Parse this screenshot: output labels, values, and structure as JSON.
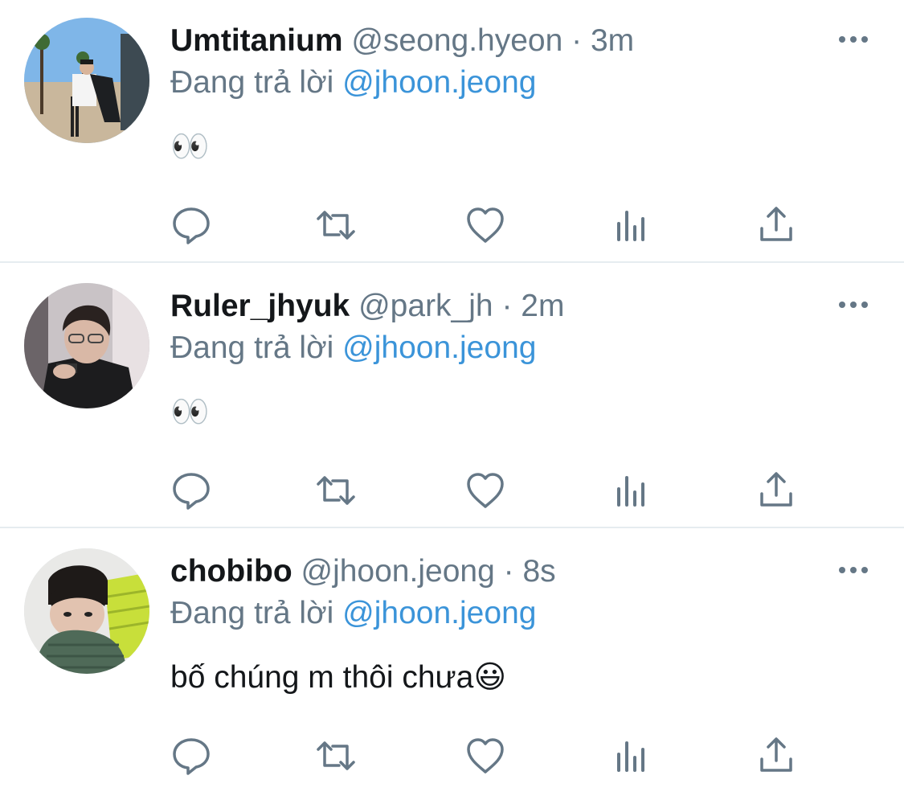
{
  "colors": {
    "link": "#3b94d9",
    "secondary_text": "#657786",
    "primary_text": "#14171a",
    "icon": "#657786",
    "divider": "#e6ecf0"
  },
  "icons": {
    "reply": "speech-bubble-icon",
    "retweet": "retweet-icon",
    "like": "heart-icon",
    "views": "bar-chart-icon",
    "share": "share-upload-icon",
    "more": "more-horizontal-icon"
  },
  "tweets": [
    {
      "display_name": "Umtitanium",
      "handle": "@seong.hyeon",
      "separator": "·",
      "time": "3m",
      "replying_prefix": "Đang trả lời",
      "replying_to": "@jhoon.jeong",
      "text": "👀"
    },
    {
      "display_name": "Ruler_jhyuk",
      "handle": "@park_jh",
      "separator": "·",
      "time": "2m",
      "replying_prefix": "Đang trả lời",
      "replying_to": "@jhoon.jeong",
      "text": "👀"
    },
    {
      "display_name": "chobibo",
      "handle": "@jhoon.jeong",
      "separator": "·",
      "time": "8s",
      "replying_prefix": "Đang trả lời",
      "replying_to": "@jhoon.jeong",
      "text": "bố chúng m thôi chưa😃"
    }
  ]
}
